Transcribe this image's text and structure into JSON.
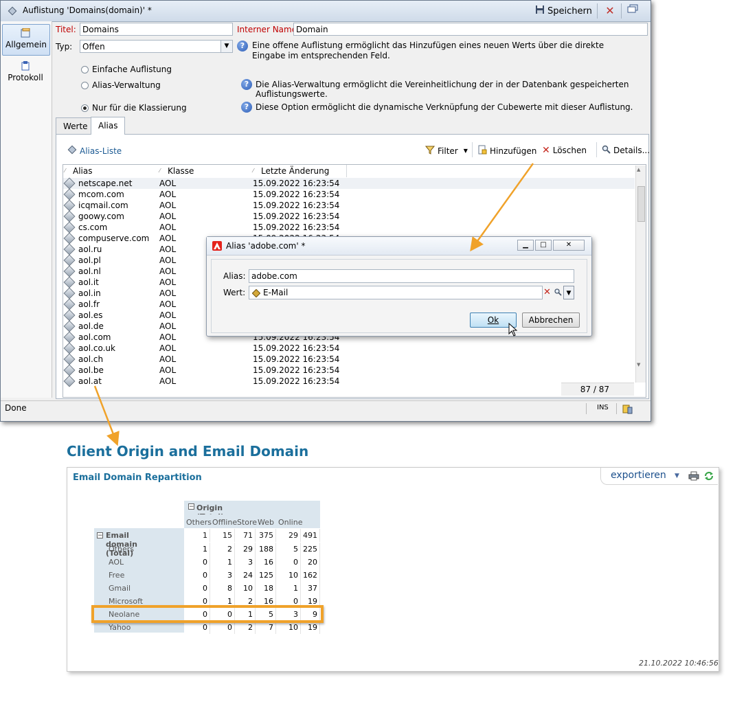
{
  "window": {
    "title": "Auflistung 'Domains(domain)' *",
    "save_label": "Speichern"
  },
  "nav": {
    "items": [
      {
        "label": "Allgemein"
      },
      {
        "label": "Protokoll"
      }
    ]
  },
  "form": {
    "title_label": "Titel:",
    "title_value": "Domains",
    "internal_label": "Interner Name:",
    "internal_value": "Domain",
    "type_label": "Typ:",
    "type_value": "Offen",
    "type_hint": "Eine offene Auflistung ermöglicht das Hinzufügen eines neuen Werts über die direkte Eingabe im entsprechenden Feld.",
    "radio_simple": "Einfache Auflistung",
    "radio_alias": "Alias-Verwaltung",
    "radio_alias_hint": "Die Alias-Verwaltung ermöglicht die Vereinheitlichung der in der Datenbank gespeicherten Auflistungswerte.",
    "radio_class": "Nur für die Klassierung",
    "radio_class_hint": "Diese Option ermöglicht die dynamische Verknüpfung der Cubewerte mit dieser Auflistung."
  },
  "tabs": [
    {
      "label": "Werte"
    },
    {
      "label": "Alias"
    }
  ],
  "alias_toolbar": {
    "list_title": "Alias-Liste",
    "filter": "Filter",
    "add": "Hinzufügen",
    "delete": "Löschen",
    "details": "Details..."
  },
  "list": {
    "columns": [
      "Alias",
      "Klasse",
      "Letzte Änderung"
    ],
    "rows": [
      {
        "alias": "netscape.net",
        "class": "AOL",
        "date": "15.09.2022 16:23:54"
      },
      {
        "alias": "mcom.com",
        "class": "AOL",
        "date": "15.09.2022 16:23:54"
      },
      {
        "alias": "icqmail.com",
        "class": "AOL",
        "date": "15.09.2022 16:23:54"
      },
      {
        "alias": "goowy.com",
        "class": "AOL",
        "date": "15.09.2022 16:23:54"
      },
      {
        "alias": "cs.com",
        "class": "AOL",
        "date": "15.09.2022 16:23:54"
      },
      {
        "alias": "compuserve.com",
        "class": "AOL",
        "date": "15.09.2022 16:23:54"
      },
      {
        "alias": "aol.ru",
        "class": "AOL",
        "date": ""
      },
      {
        "alias": "aol.pl",
        "class": "AOL",
        "date": ""
      },
      {
        "alias": "aol.nl",
        "class": "AOL",
        "date": ""
      },
      {
        "alias": "aol.it",
        "class": "AOL",
        "date": ""
      },
      {
        "alias": "aol.in",
        "class": "AOL",
        "date": ""
      },
      {
        "alias": "aol.fr",
        "class": "AOL",
        "date": ""
      },
      {
        "alias": "aol.es",
        "class": "AOL",
        "date": ""
      },
      {
        "alias": "aol.de",
        "class": "AOL",
        "date": ""
      },
      {
        "alias": "aol.com",
        "class": "AOL",
        "date": "15.09.2022 16:23:54"
      },
      {
        "alias": "aol.co.uk",
        "class": "AOL",
        "date": "15.09.2022 16:23:54"
      },
      {
        "alias": "aol.ch",
        "class": "AOL",
        "date": "15.09.2022 16:23:54"
      },
      {
        "alias": "aol.be",
        "class": "AOL",
        "date": "15.09.2022 16:23:54"
      },
      {
        "alias": "aol.at",
        "class": "AOL",
        "date": "15.09.2022 16:23:54"
      }
    ],
    "count": "87 / 87"
  },
  "status": {
    "text": "Done",
    "ins": "INS"
  },
  "dialog": {
    "title": "Alias 'adobe.com' *",
    "alias_label": "Alias:",
    "alias_value": "adobe.com",
    "wert_label": "Wert:",
    "wert_value": "E-Mail",
    "ok": "Ok",
    "cancel": "Abbrechen"
  },
  "report": {
    "title": "Client Origin and Email Domain",
    "subtitle": "Email Domain Repartition",
    "export": "exportieren",
    "timestamp": "21.10.2022 10:46:56",
    "origin_header": "Origin (Total)",
    "origin_cols": [
      "Others",
      "Offline",
      "Store",
      "Web",
      "Online"
    ],
    "domain_header": "Email domain (Total)",
    "total_row": [
      "1",
      "15",
      "71",
      "375",
      "29",
      "491"
    ],
    "rows": [
      {
        "label": "Others",
        "values": [
          "1",
          "2",
          "29",
          "188",
          "5",
          "225"
        ]
      },
      {
        "label": "AOL",
        "values": [
          "0",
          "1",
          "3",
          "16",
          "0",
          "20"
        ]
      },
      {
        "label": "Free",
        "values": [
          "0",
          "3",
          "24",
          "125",
          "10",
          "162"
        ]
      },
      {
        "label": "Gmail",
        "values": [
          "0",
          "8",
          "10",
          "18",
          "1",
          "37"
        ]
      },
      {
        "label": "Microsoft",
        "values": [
          "0",
          "1",
          "2",
          "16",
          "0",
          "19"
        ]
      },
      {
        "label": "Neolane",
        "values": [
          "0",
          "0",
          "1",
          "5",
          "3",
          "9"
        ]
      },
      {
        "label": "Yahoo",
        "values": [
          "0",
          "0",
          "2",
          "7",
          "10",
          "19"
        ]
      }
    ]
  },
  "colors": {
    "accent_blue": "#1b6f9c",
    "highlight_orange": "#f0a22a",
    "required_red": "#c00000"
  }
}
